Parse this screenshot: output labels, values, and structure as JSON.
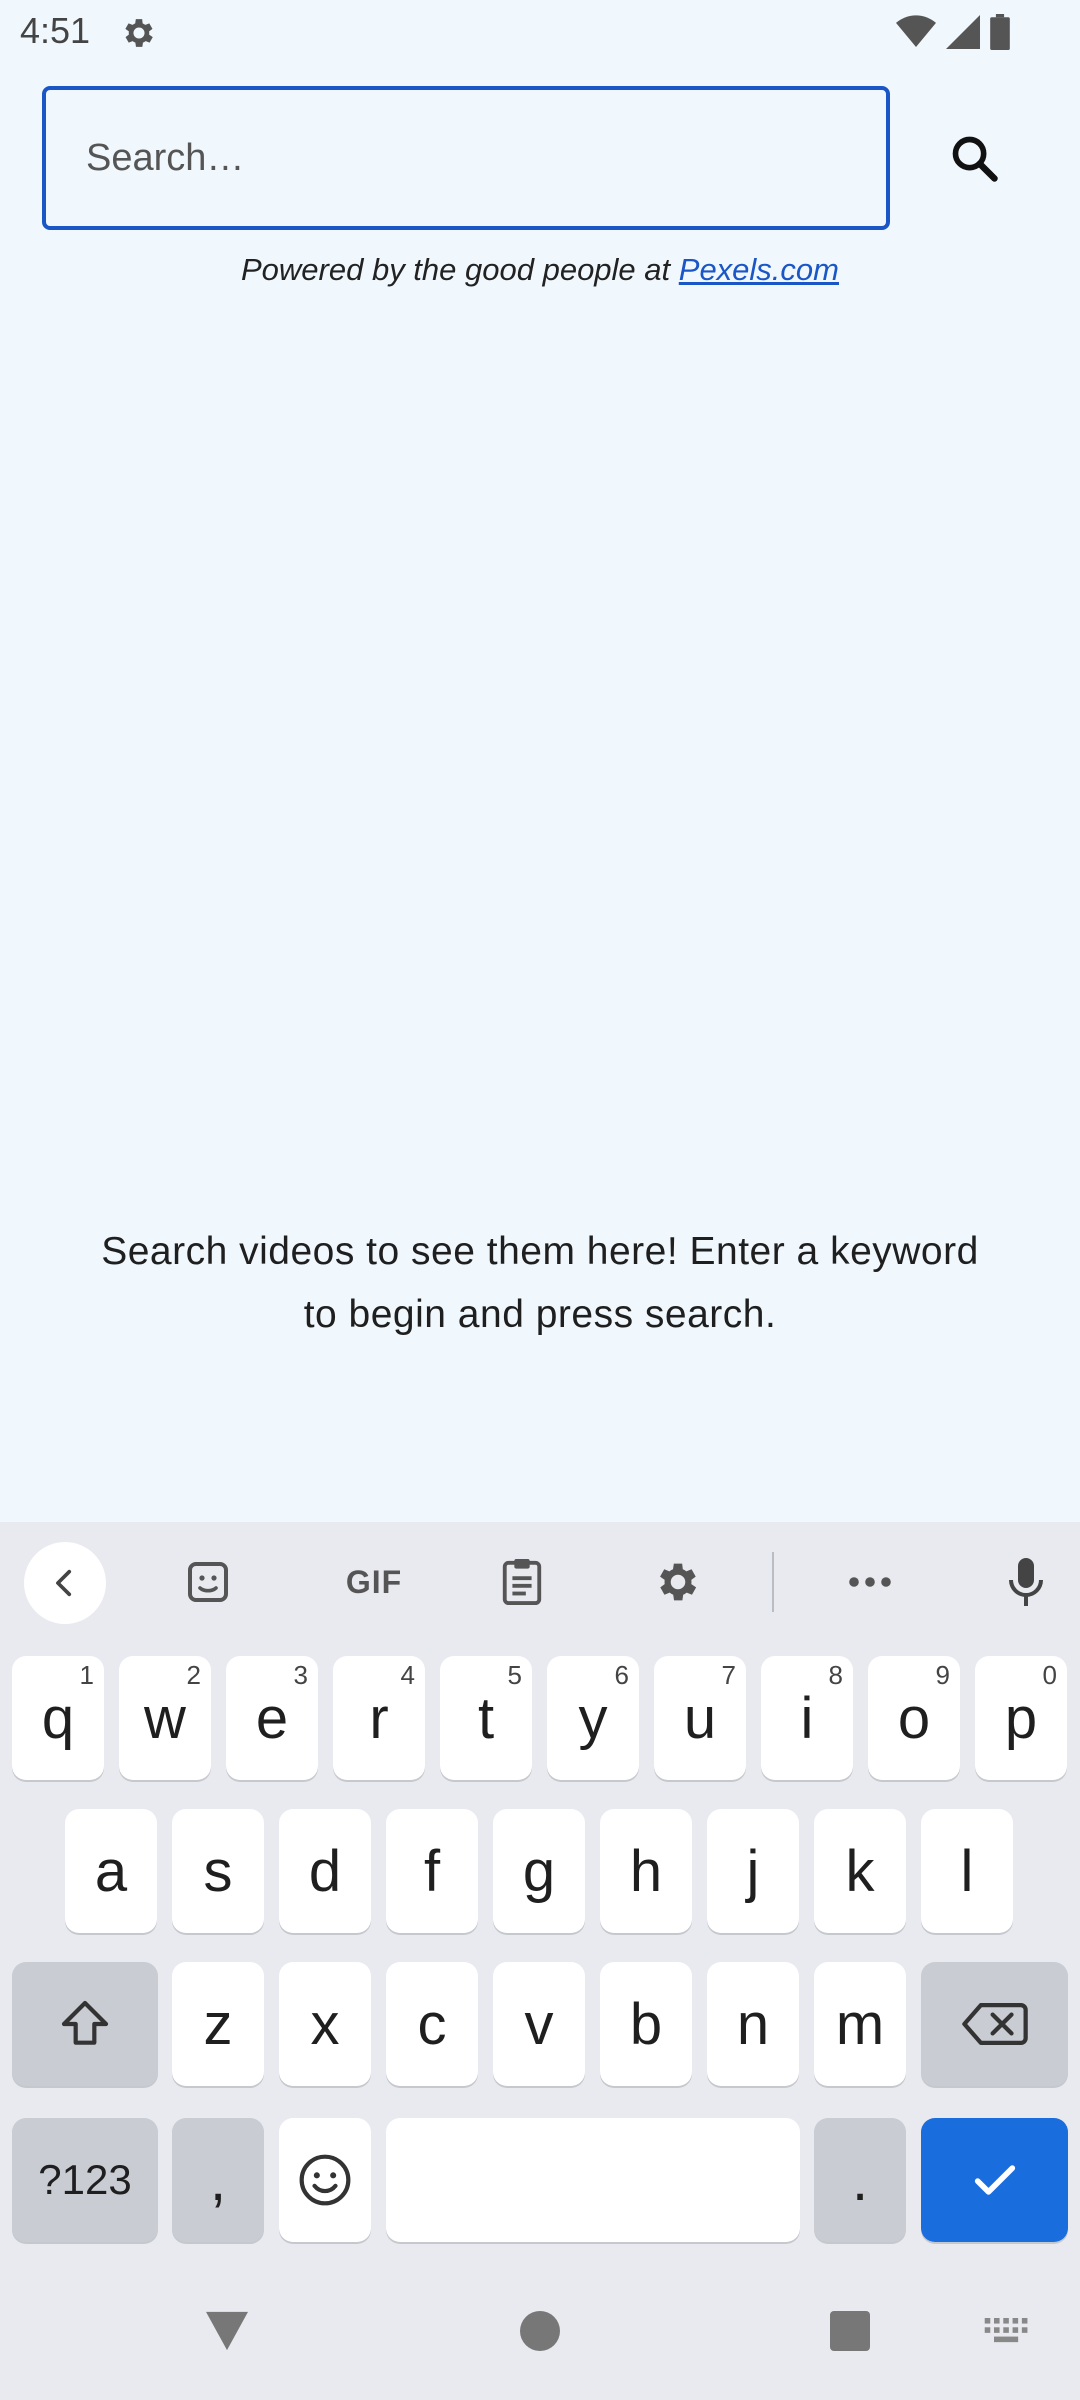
{
  "status_bar": {
    "time": "4:51",
    "icons": [
      "gear-icon",
      "wifi-icon",
      "signal-icon",
      "battery-icon"
    ]
  },
  "search": {
    "placeholder": "Search…",
    "value": "",
    "button_icon": "search-icon"
  },
  "attribution": {
    "prefix": "Powered by the good people at ",
    "link": "Pexels.com"
  },
  "empty_state": {
    "line1": "Search videos to see them here! Enter a keyword",
    "line2": "to begin and press search."
  },
  "keyboard": {
    "toolbar": {
      "back_icon": "chevron-left-icon",
      "sticker_icon": "sticker-icon",
      "gif_label": "GIF",
      "clipboard_icon": "clipboard-icon",
      "settings_icon": "gear-icon",
      "more_icon": "more-horizontal-icon",
      "mic_icon": "mic-icon"
    },
    "row1": [
      {
        "key": "q",
        "hint": "1"
      },
      {
        "key": "w",
        "hint": "2"
      },
      {
        "key": "e",
        "hint": "3"
      },
      {
        "key": "r",
        "hint": "4"
      },
      {
        "key": "t",
        "hint": "5"
      },
      {
        "key": "y",
        "hint": "6"
      },
      {
        "key": "u",
        "hint": "7"
      },
      {
        "key": "i",
        "hint": "8"
      },
      {
        "key": "o",
        "hint": "9"
      },
      {
        "key": "p",
        "hint": "0"
      }
    ],
    "row2": [
      "a",
      "s",
      "d",
      "f",
      "g",
      "h",
      "j",
      "k",
      "l"
    ],
    "row3": [
      "z",
      "x",
      "c",
      "v",
      "b",
      "n",
      "m"
    ],
    "row4": {
      "symbols": "?123",
      "comma": ",",
      "period": ".",
      "enter_icon": "check-icon"
    },
    "accent_color": "#1a6ddc"
  },
  "nav_bar": {
    "icons": [
      "back-triangle-icon",
      "home-circle-icon",
      "recents-square-icon",
      "keyboard-switch-icon"
    ]
  }
}
